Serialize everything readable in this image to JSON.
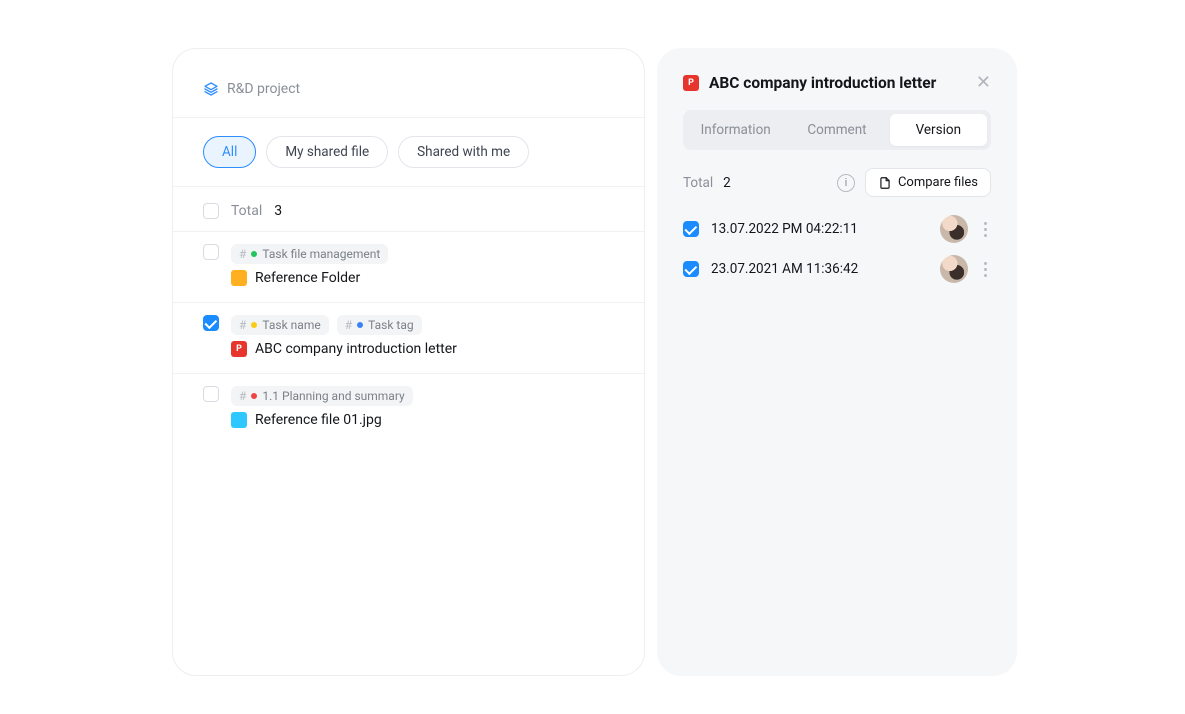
{
  "project": {
    "name": "R&D project"
  },
  "filters": {
    "all": "All",
    "my_shared": "My shared file",
    "shared_with_me": "Shared with me"
  },
  "list": {
    "total_label": "Total",
    "total_count": "3"
  },
  "files": [
    {
      "checked": false,
      "tags": [
        {
          "color": "#22c55e",
          "label": "Task file management"
        }
      ],
      "icon": "folder",
      "name": "Reference Folder"
    },
    {
      "checked": true,
      "tags": [
        {
          "color": "#facc15",
          "label": "Task name"
        },
        {
          "color": "#3b82f6",
          "label": "Task tag"
        }
      ],
      "icon": "ppt",
      "name": "ABC company introduction letter"
    },
    {
      "checked": false,
      "tags": [
        {
          "color": "#ef4444",
          "label": "1.1 Planning and summary"
        }
      ],
      "icon": "doc",
      "name": "Reference file 01.jpg"
    }
  ],
  "detail": {
    "icon": "ppt",
    "title": "ABC company introduction letter",
    "tabs": {
      "information": "Information",
      "comment": "Comment",
      "version": "Version"
    },
    "version_total_label": "Total",
    "version_total_count": "2",
    "compare_label": "Compare files",
    "versions": [
      {
        "checked": true,
        "timestamp": "13.07.2022 PM 04:22:11"
      },
      {
        "checked": true,
        "timestamp": "23.07.2021 AM 11:36:42"
      }
    ]
  }
}
